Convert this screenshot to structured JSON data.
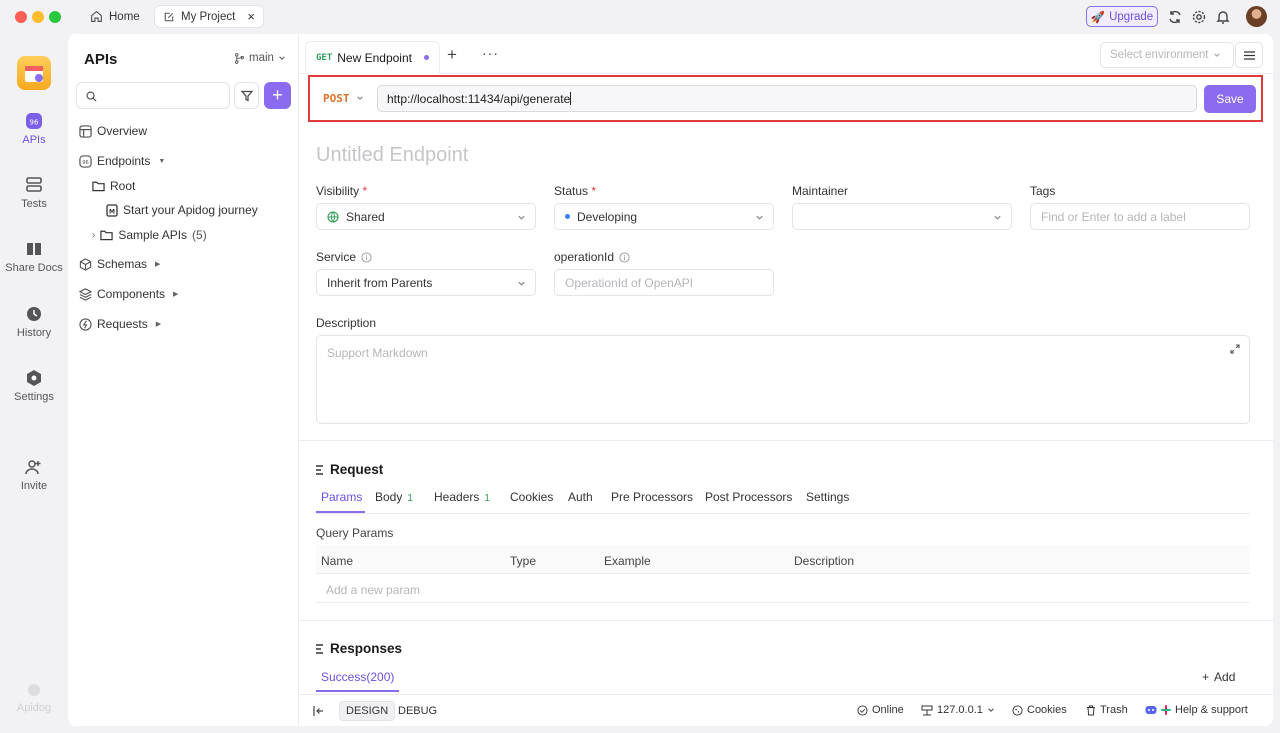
{
  "titlebar": {
    "tabs": [
      {
        "label": "Home"
      },
      {
        "label": "My Project"
      }
    ],
    "upgrade_label": "Upgrade"
  },
  "nav": {
    "items": [
      {
        "label": "APIs",
        "icon": "apis-icon"
      },
      {
        "label": "Tests",
        "icon": "tests-icon"
      },
      {
        "label": "Share Docs",
        "icon": "book-icon"
      },
      {
        "label": "History",
        "icon": "clock-icon"
      },
      {
        "label": "Settings",
        "icon": "gear-icon"
      },
      {
        "label": "Invite",
        "icon": "add-user-icon"
      }
    ],
    "brand": "Apidog"
  },
  "sidebar": {
    "title": "APIs",
    "branch": "main",
    "tree": [
      {
        "label": "Overview"
      },
      {
        "label": "Endpoints"
      },
      {
        "label": "Root"
      },
      {
        "label": "Start your Apidog journey"
      },
      {
        "label": "Sample APIs",
        "count": "(5)"
      },
      {
        "label": "Schemas"
      },
      {
        "label": "Components"
      },
      {
        "label": "Requests"
      }
    ]
  },
  "tab": {
    "method": "GET",
    "label": "New Endpoint"
  },
  "environment": {
    "placeholder": "Select environment"
  },
  "request_line": {
    "method": "POST",
    "url": "http://localhost:11434/api/generate",
    "save_label": "Save"
  },
  "form": {
    "title_placeholder": "Untitled Endpoint",
    "visibility": {
      "label": "Visibility",
      "value": "Shared"
    },
    "status": {
      "label": "Status",
      "value": "Developing"
    },
    "maintainer": {
      "label": "Maintainer"
    },
    "tags": {
      "label": "Tags",
      "placeholder": "Find or Enter to add a label"
    },
    "service": {
      "label": "Service",
      "value": "Inherit from Parents"
    },
    "operation_id": {
      "label": "operationId",
      "placeholder": "OperationId of OpenAPI"
    },
    "description": {
      "label": "Description",
      "placeholder": "Support Markdown"
    }
  },
  "request": {
    "title": "Request",
    "tabs": [
      {
        "label": "Params"
      },
      {
        "label": "Body",
        "badge": "1"
      },
      {
        "label": "Headers",
        "badge": "1"
      },
      {
        "label": "Cookies"
      },
      {
        "label": "Auth"
      },
      {
        "label": "Pre Processors"
      },
      {
        "label": "Post Processors"
      },
      {
        "label": "Settings"
      }
    ],
    "query_params_label": "Query Params",
    "columns": [
      "Name",
      "Type",
      "Example",
      "Description"
    ],
    "add_param": "Add a new param"
  },
  "responses": {
    "title": "Responses",
    "tab": "Success(200)",
    "add_label": "Add"
  },
  "statusbar": {
    "design": "DESIGN",
    "debug": "DEBUG",
    "online": "Online",
    "host": "127.0.0.1",
    "cookies": "Cookies",
    "trash": "Trash",
    "help": "Help & support"
  },
  "colors": {
    "accent": "#8b6cf0",
    "post": "#e0702b",
    "get": "#2f9e5b",
    "highlight": "#e03b3b"
  }
}
